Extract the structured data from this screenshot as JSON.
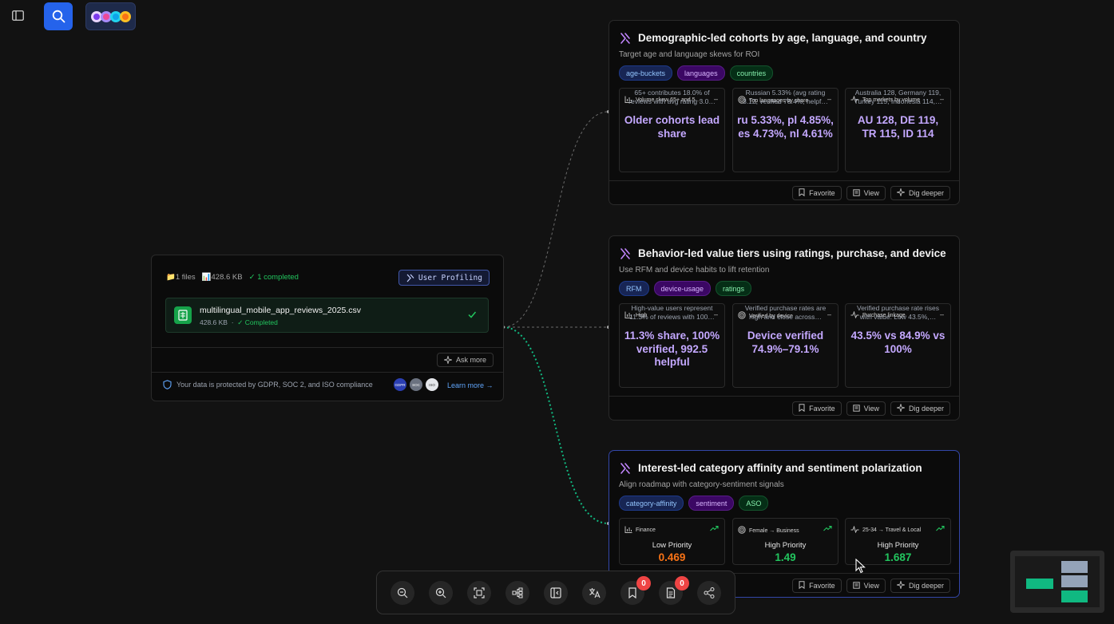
{
  "topbar": {
    "sidebar_toggle_icon": "sidebar-toggle-icon",
    "search_icon": "search-icon",
    "avatars_icon": "avatar-stack"
  },
  "source": {
    "files_label": "1 files",
    "size_label": "428.6 KB",
    "completed_label": "✓ 1 completed",
    "profile_tag": "User Profiling",
    "file_name": "multilingual_mobile_app_reviews_2025.csv",
    "file_size": "428.6 KB",
    "file_sep": "·",
    "file_status": "✓ Completed",
    "ask_more": "Ask more",
    "privacy_text": "Your data is protected by GDPR, SOC 2, and ISO compliance",
    "badge_1": "GDPR",
    "badge_2": "SOC",
    "badge_3": "ISO",
    "learn_more": "Learn more →"
  },
  "cards": [
    {
      "title": "Demographic-led cohorts by age, language, and country",
      "subtitle": "Target age and language skews for ROI",
      "chips": [
        "age-buckets",
        "languages",
        "countries"
      ],
      "metrics": [
        {
          "label": "Volume skew 65+ and 5…",
          "icon": "bar-chart-icon",
          "value": "Older cohorts lead share",
          "desc": "65+ contributes 18.0% of reviews with avg rating 3.0…"
        },
        {
          "label": "Top languages by share",
          "icon": "target-icon",
          "value": "ru 5.33%, pl 4.85%, es 4.73%, nl 4.61%",
          "desc": "Russian 5.33% (avg rating 3.12, verified 78.4%, helpf…"
        },
        {
          "label": "Top markets by volume",
          "icon": "pulse-icon",
          "value": "AU 128, DE 119, TR 115, ID 114",
          "desc": "Australia 128, Germany 119, Turkey 115, Indonesia 114,…"
        }
      ],
      "actions": [
        "Favorite",
        "View",
        "Dig deeper"
      ]
    },
    {
      "title": "Behavior-led value tiers using ratings, purchase, and device",
      "subtitle": "Use RFM and device habits to lift retention",
      "chips": [
        "RFM",
        "device-usage",
        "ratings"
      ],
      "metrics": [
        {
          "label": "High",
          "icon": "bar-chart-icon",
          "value": "11.3% share, 100% verified, 992.5 helpful",
          "desc": "High-value users represent 11.3% of reviews with 100…"
        },
        {
          "label": "Verified by device",
          "icon": "target-icon",
          "value": "Device verified 74.9%–79.1%",
          "desc": "Verified purchase rates are high and close across…"
        },
        {
          "label": "Purchase linkage",
          "icon": "pulse-icon",
          "value": "43.5% vs 84.9% vs 100%",
          "desc": "Verified purchase rate rises with value: Low 43.5%,…"
        }
      ],
      "actions": [
        "Favorite",
        "View",
        "Dig deeper"
      ]
    },
    {
      "title": "Interest-led category affinity and sentiment polarization",
      "subtitle": "Align roadmap with category-sentiment signals",
      "chips": [
        "category-affinity",
        "sentiment",
        "ASO"
      ],
      "metrics": [
        {
          "label": "Finance",
          "icon": "bar-chart-icon",
          "priority": "Low Priority",
          "score": "0.469",
          "score_color": "#f97316"
        },
        {
          "label": "Female → Business",
          "icon": "target-icon",
          "priority": "High Priority",
          "score": "1.49",
          "score_color": "#22c55e"
        },
        {
          "label": "25-34 → Travel & Local",
          "icon": "pulse-icon",
          "priority": "High Priority",
          "score": "1.687",
          "score_color": "#22c55e"
        }
      ],
      "actions": [
        "Favorite",
        "View",
        "Dig deeper"
      ]
    }
  ],
  "toolbar": {
    "buttons": [
      "zoom-out-icon",
      "zoom-in-icon",
      "fit-view-icon",
      "layout-tree-icon",
      "collapse-panel-icon",
      "translate-icon",
      "bookmark-icon",
      "notes-icon",
      "share-icon"
    ],
    "bookmark_count": "0",
    "notes_count": "0"
  },
  "colors": {
    "accent": "#2563eb",
    "purple": "#c4a8ff",
    "green": "#22c55e",
    "orange": "#f97316",
    "connector_green": "#10b981"
  }
}
